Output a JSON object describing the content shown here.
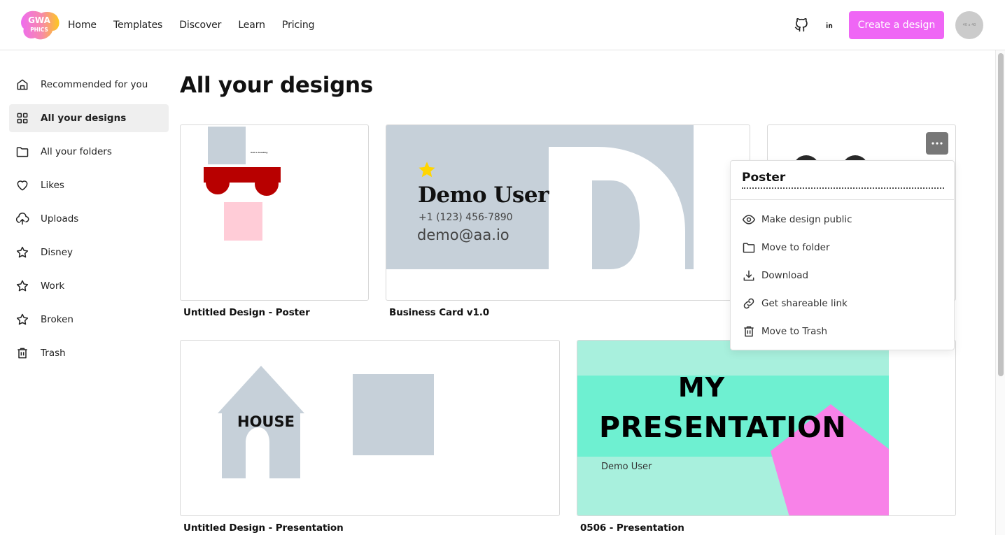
{
  "header": {
    "logo_text_top": "GWA",
    "logo_text_bottom": "PHICS",
    "nav": [
      {
        "label": "Home"
      },
      {
        "label": "Templates"
      },
      {
        "label": "Discover"
      },
      {
        "label": "Learn"
      },
      {
        "label": "Pricing"
      }
    ],
    "github_icon": "github-icon",
    "linkedin_icon": "linkedin-icon",
    "create_button_label": "Create a design",
    "avatar_text": "40 x 40",
    "accent_color": "#ef66f5"
  },
  "sidebar": {
    "items": [
      {
        "label": "Recommended for you",
        "icon": "home-icon",
        "active": false
      },
      {
        "label": "All your designs",
        "icon": "grid-icon",
        "active": true
      },
      {
        "label": "All your folders",
        "icon": "folder-icon",
        "active": false
      },
      {
        "label": "Likes",
        "icon": "heart-icon",
        "active": false
      },
      {
        "label": "Uploads",
        "icon": "upload-cloud-icon",
        "active": false
      },
      {
        "label": "Disney",
        "icon": "star-icon",
        "active": false
      },
      {
        "label": "Work",
        "icon": "star-icon",
        "active": false
      },
      {
        "label": "Broken",
        "icon": "star-icon",
        "active": false
      },
      {
        "label": "Trash",
        "icon": "trash-icon",
        "active": false
      }
    ]
  },
  "main": {
    "title": "All your designs",
    "designs": [
      {
        "title": "Untitled Design - Poster",
        "preview": {
          "heading_text": "Add a heading"
        }
      },
      {
        "title": "Business Card v1.0",
        "preview": {
          "name": "Demo User",
          "phone": "+1 (123) 456-7890",
          "email": "demo@aa.io",
          "big_letter": "D"
        }
      },
      {
        "title": "Poster",
        "preview": {}
      },
      {
        "title": "Untitled Design - Presentation",
        "preview": {
          "house_text": "HOUSE"
        }
      },
      {
        "title": "0506 - Presentation",
        "preview": {
          "line1": "MY",
          "line2": "PRESENTATION",
          "author": "Demo User"
        }
      }
    ]
  },
  "context_menu": {
    "title": "Poster",
    "items": [
      {
        "label": "Make design public",
        "icon": "eye-icon"
      },
      {
        "label": "Move to folder",
        "icon": "folder-icon"
      },
      {
        "label": "Download",
        "icon": "download-icon"
      },
      {
        "label": "Get shareable link",
        "icon": "link-icon"
      },
      {
        "label": "Move to Trash",
        "icon": "trash-icon"
      }
    ]
  }
}
